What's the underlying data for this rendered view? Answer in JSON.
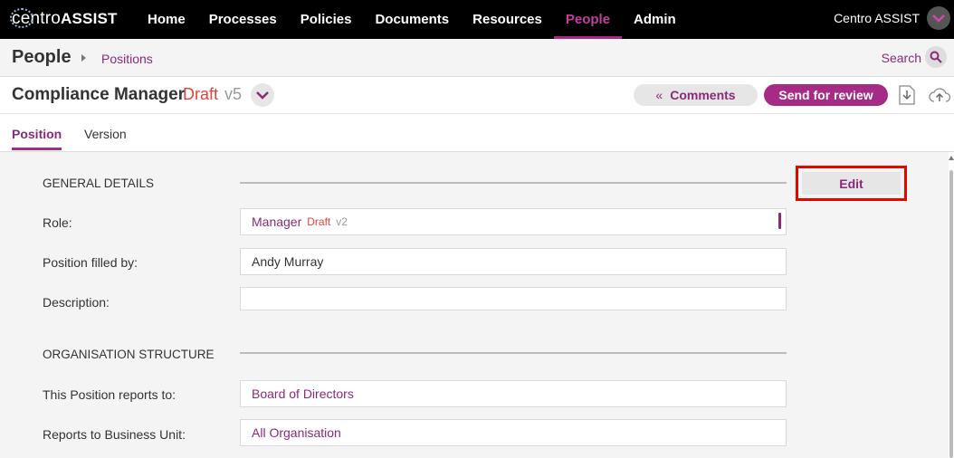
{
  "app": {
    "logo_prefix": "centro",
    "logo_suffix": "ASSIST",
    "user_name": "Centro ASSIST"
  },
  "nav": {
    "items": [
      {
        "label": "Home",
        "active": false
      },
      {
        "label": "Processes",
        "active": false
      },
      {
        "label": "Policies",
        "active": false
      },
      {
        "label": "Documents",
        "active": false
      },
      {
        "label": "Resources",
        "active": false
      },
      {
        "label": "People",
        "active": true
      },
      {
        "label": "Admin",
        "active": false
      }
    ]
  },
  "breadcrumb": {
    "title": "People",
    "link": "Positions",
    "search_label": "Search"
  },
  "document": {
    "title": "Compliance Manager",
    "status": "Draft",
    "version": "v5",
    "comments_label": "Comments",
    "review_label": "Send for review"
  },
  "tabs": [
    {
      "label": "Position",
      "active": true
    },
    {
      "label": "Version",
      "active": false
    }
  ],
  "general": {
    "section_title": "GENERAL DETAILS",
    "edit_label": "Edit",
    "role_label": "Role:",
    "role_value": "Manager",
    "role_status": "Draft",
    "role_version": "v2",
    "filled_by_label": "Position filled by:",
    "filled_by_value": "Andy Murray",
    "description_label": "Description:",
    "description_value": ""
  },
  "org": {
    "section_title": "ORGANISATION STRUCTURE",
    "reports_to_label": "This Position reports to:",
    "reports_to_value": "Board of Directors",
    "business_unit_label": "Reports to Business Unit:",
    "business_unit_value": "All Organisation"
  },
  "colors": {
    "accent": "#a62b86",
    "link": "#8a2a7a",
    "draft": "#d9443d",
    "highlight": "#e00000"
  }
}
